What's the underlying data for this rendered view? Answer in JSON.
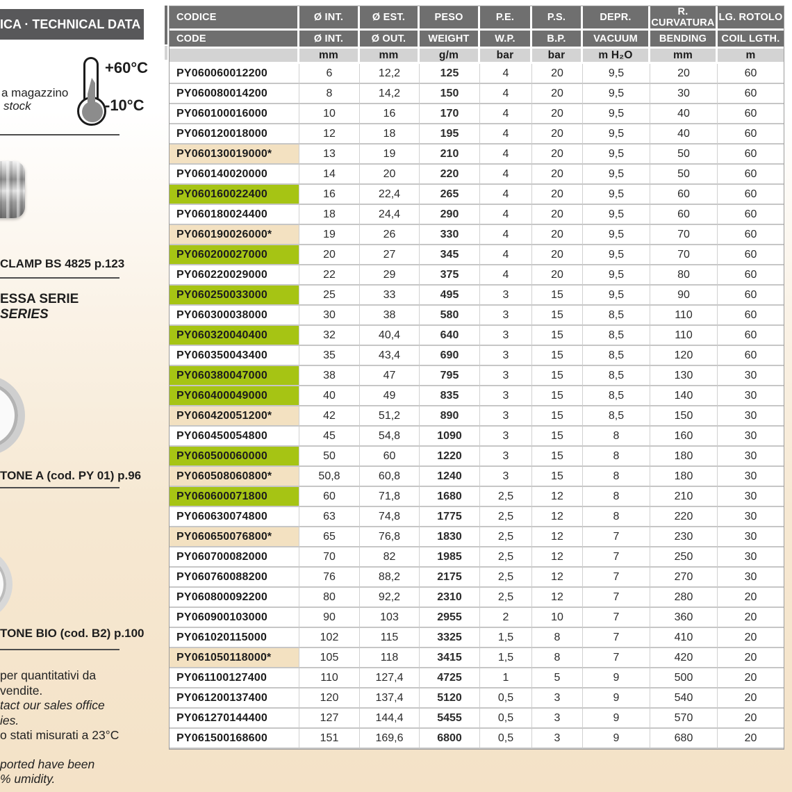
{
  "page": {
    "bg_top": "#ffffff",
    "bg_bottom": "#f4e2c7"
  },
  "sidebar": {
    "title": "ICA · TECHNICAL DATA",
    "thermometer": {
      "temp_high": "+60°C",
      "temp_low": "-10°C"
    },
    "stock_line1": "a magazzino",
    "stock_line2": "stock",
    "clamp_link": "CLAMP BS 4825 p.123",
    "series_line1": "ESSA SERIE",
    "series_line2": "SERIES",
    "link_a": "TONE A  (cod. PY 01) p.96",
    "link_bio": "TONE BIO (cod. B2) p.100",
    "notes": [
      {
        "text": "per quantitativi da",
        "italic": false
      },
      {
        "text": "vendite.",
        "italic": false
      },
      {
        "text": "tact our sales office",
        "italic": true
      },
      {
        "text": "ies.",
        "italic": true
      },
      {
        "text": "o stati misurati a 23°C",
        "italic": false
      },
      {
        "text": "ported have been",
        "italic": true
      },
      {
        "text": "% umidity.",
        "italic": true
      }
    ]
  },
  "table": {
    "colors": {
      "green": "#a6c414",
      "beige": "#f3e1c1",
      "header_bg": "#6f6f6f",
      "units_bg": "#d3d3d3"
    },
    "header_row1": [
      "CODICE",
      "Ø INT.",
      "Ø EST.",
      "PESO",
      "P.E.",
      "P.S.",
      "DEPR.",
      "R. CURVATURA",
      "LG. ROTOLO"
    ],
    "header_row2": [
      "CODE",
      "Ø INT.",
      "Ø OUT.",
      "WEIGHT",
      "W.P.",
      "B.P.",
      "VACUUM",
      "BENDING",
      "COIL LGTH."
    ],
    "units": [
      "",
      "mm",
      "mm",
      "g/m",
      "bar",
      "bar",
      "m H₂O",
      "mm",
      "m"
    ],
    "rows": [
      {
        "code": "PY060060012200",
        "highlight": "none",
        "values": [
          "6",
          "12,2",
          "125",
          "4",
          "20",
          "9,5",
          "20",
          "60"
        ]
      },
      {
        "code": "PY060080014200",
        "highlight": "none",
        "values": [
          "8",
          "14,2",
          "150",
          "4",
          "20",
          "9,5",
          "30",
          "60"
        ]
      },
      {
        "code": "PY060100016000",
        "highlight": "none",
        "values": [
          "10",
          "16",
          "170",
          "4",
          "20",
          "9,5",
          "40",
          "60"
        ]
      },
      {
        "code": "PY060120018000",
        "highlight": "none",
        "values": [
          "12",
          "18",
          "195",
          "4",
          "20",
          "9,5",
          "40",
          "60"
        ]
      },
      {
        "code": "PY060130019000*",
        "highlight": "beige",
        "values": [
          "13",
          "19",
          "210",
          "4",
          "20",
          "9,5",
          "50",
          "60"
        ]
      },
      {
        "code": "PY060140020000",
        "highlight": "none",
        "values": [
          "14",
          "20",
          "220",
          "4",
          "20",
          "9,5",
          "50",
          "60"
        ]
      },
      {
        "code": "PY060160022400",
        "highlight": "green",
        "values": [
          "16",
          "22,4",
          "265",
          "4",
          "20",
          "9,5",
          "60",
          "60"
        ]
      },
      {
        "code": "PY060180024400",
        "highlight": "none",
        "values": [
          "18",
          "24,4",
          "290",
          "4",
          "20",
          "9,5",
          "60",
          "60"
        ]
      },
      {
        "code": "PY060190026000*",
        "highlight": "beige",
        "values": [
          "19",
          "26",
          "330",
          "4",
          "20",
          "9,5",
          "70",
          "60"
        ]
      },
      {
        "code": "PY060200027000",
        "highlight": "green",
        "values": [
          "20",
          "27",
          "345",
          "4",
          "20",
          "9,5",
          "70",
          "60"
        ]
      },
      {
        "code": "PY060220029000",
        "highlight": "none",
        "values": [
          "22",
          "29",
          "375",
          "4",
          "20",
          "9,5",
          "80",
          "60"
        ]
      },
      {
        "code": "PY060250033000",
        "highlight": "green",
        "values": [
          "25",
          "33",
          "495",
          "3",
          "15",
          "9,5",
          "90",
          "60"
        ]
      },
      {
        "code": "PY060300038000",
        "highlight": "none",
        "values": [
          "30",
          "38",
          "580",
          "3",
          "15",
          "8,5",
          "110",
          "60"
        ]
      },
      {
        "code": "PY060320040400",
        "highlight": "green",
        "values": [
          "32",
          "40,4",
          "640",
          "3",
          "15",
          "8,5",
          "110",
          "60"
        ]
      },
      {
        "code": "PY060350043400",
        "highlight": "none",
        "values": [
          "35",
          "43,4",
          "690",
          "3",
          "15",
          "8,5",
          "120",
          "60"
        ]
      },
      {
        "code": "PY060380047000",
        "highlight": "green",
        "values": [
          "38",
          "47",
          "795",
          "3",
          "15",
          "8,5",
          "130",
          "30"
        ]
      },
      {
        "code": "PY060400049000",
        "highlight": "green",
        "values": [
          "40",
          "49",
          "835",
          "3",
          "15",
          "8,5",
          "140",
          "30"
        ]
      },
      {
        "code": "PY060420051200*",
        "highlight": "beige",
        "values": [
          "42",
          "51,2",
          "890",
          "3",
          "15",
          "8,5",
          "150",
          "30"
        ]
      },
      {
        "code": "PY060450054800",
        "highlight": "none",
        "values": [
          "45",
          "54,8",
          "1090",
          "3",
          "15",
          "8",
          "160",
          "30"
        ]
      },
      {
        "code": "PY060500060000",
        "highlight": "green",
        "values": [
          "50",
          "60",
          "1220",
          "3",
          "15",
          "8",
          "180",
          "30"
        ]
      },
      {
        "code": "PY060508060800*",
        "highlight": "beige",
        "values": [
          "50,8",
          "60,8",
          "1240",
          "3",
          "15",
          "8",
          "180",
          "30"
        ]
      },
      {
        "code": "PY060600071800",
        "highlight": "green",
        "values": [
          "60",
          "71,8",
          "1680",
          "2,5",
          "12",
          "8",
          "210",
          "30"
        ]
      },
      {
        "code": "PY060630074800",
        "highlight": "none",
        "values": [
          "63",
          "74,8",
          "1775",
          "2,5",
          "12",
          "8",
          "220",
          "30"
        ]
      },
      {
        "code": "PY060650076800*",
        "highlight": "beige",
        "values": [
          "65",
          "76,8",
          "1830",
          "2,5",
          "12",
          "7",
          "230",
          "30"
        ]
      },
      {
        "code": "PY060700082000",
        "highlight": "none",
        "values": [
          "70",
          "82",
          "1985",
          "2,5",
          "12",
          "7",
          "250",
          "30"
        ]
      },
      {
        "code": "PY060760088200",
        "highlight": "none",
        "values": [
          "76",
          "88,2",
          "2175",
          "2,5",
          "12",
          "7",
          "270",
          "30"
        ]
      },
      {
        "code": "PY060800092200",
        "highlight": "none",
        "values": [
          "80",
          "92,2",
          "2310",
          "2,5",
          "12",
          "7",
          "280",
          "20"
        ]
      },
      {
        "code": "PY060900103000",
        "highlight": "none",
        "values": [
          "90",
          "103",
          "2955",
          "2",
          "10",
          "7",
          "360",
          "20"
        ]
      },
      {
        "code": "PY061020115000",
        "highlight": "none",
        "values": [
          "102",
          "115",
          "3325",
          "1,5",
          "8",
          "7",
          "410",
          "20"
        ]
      },
      {
        "code": "PY061050118000*",
        "highlight": "beige",
        "values": [
          "105",
          "118",
          "3415",
          "1,5",
          "8",
          "7",
          "420",
          "20"
        ]
      },
      {
        "code": "PY061100127400",
        "highlight": "none",
        "values": [
          "110",
          "127,4",
          "4725",
          "1",
          "5",
          "9",
          "500",
          "20"
        ]
      },
      {
        "code": "PY061200137400",
        "highlight": "none",
        "values": [
          "120",
          "137,4",
          "5120",
          "0,5",
          "3",
          "9",
          "540",
          "20"
        ]
      },
      {
        "code": "PY061270144400",
        "highlight": "none",
        "values": [
          "127",
          "144,4",
          "5455",
          "0,5",
          "3",
          "9",
          "570",
          "20"
        ]
      },
      {
        "code": "PY061500168600",
        "highlight": "none",
        "values": [
          "151",
          "169,6",
          "6800",
          "0,5",
          "3",
          "9",
          "680",
          "20"
        ]
      }
    ]
  }
}
